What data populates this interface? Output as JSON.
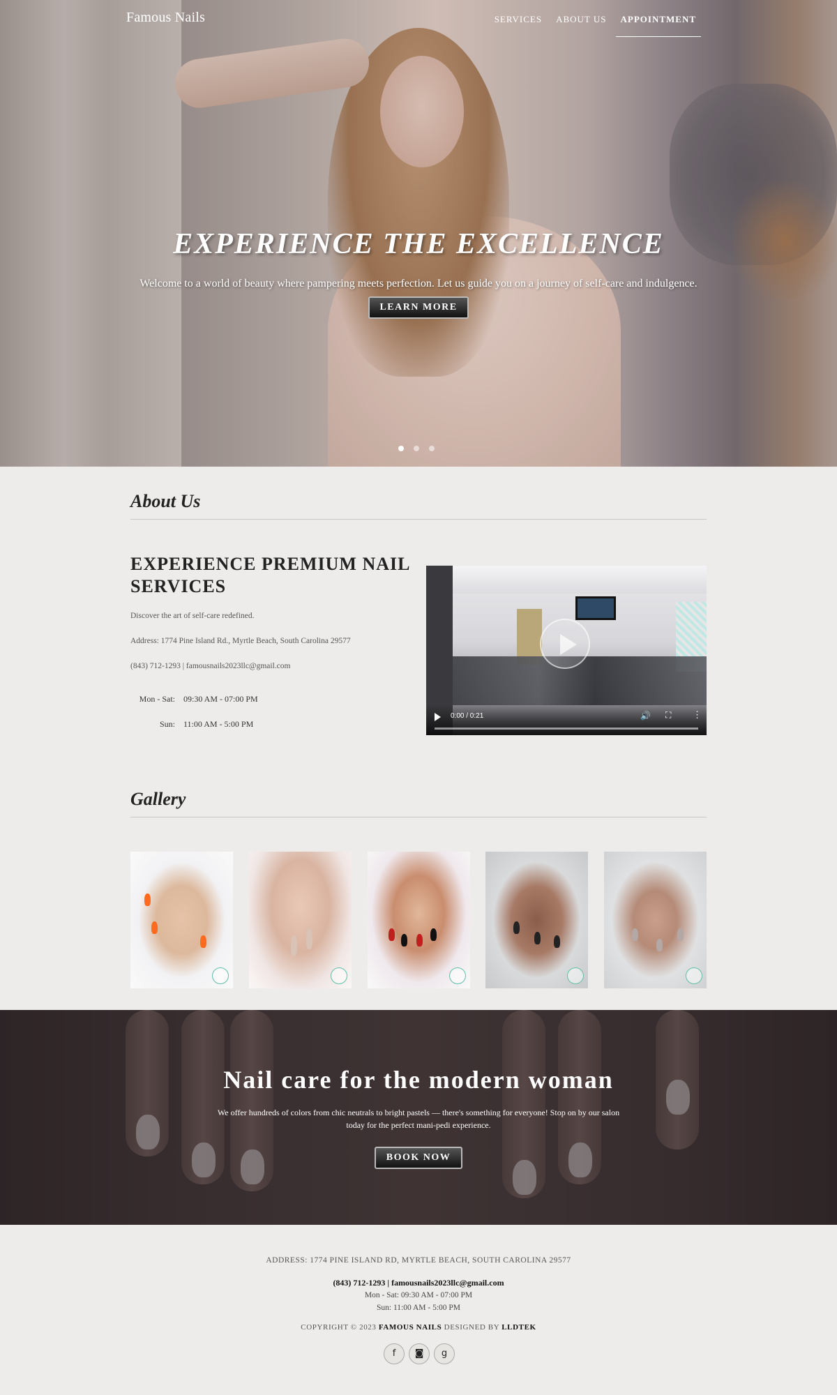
{
  "header": {
    "brand": "Famous Nails",
    "nav": [
      {
        "label": "SERVICES",
        "active": false
      },
      {
        "label": "ABOUT US",
        "active": false
      },
      {
        "label": "APPOINTMENT",
        "active": true
      }
    ]
  },
  "hero": {
    "title": "EXPERIENCE THE EXCELLENCE",
    "subtitle": "Welcome to a world of beauty where pampering meets perfection. Let us guide you on a journey of self-care and indulgence.",
    "button_label": "LEARN MORE",
    "slides_total": 3,
    "active_slide": 1
  },
  "about": {
    "heading": "About Us",
    "title": "EXPERIENCE PREMIUM NAIL SERVICES",
    "tagline": "Discover the art of self-care redefined.",
    "address": "Address: 1774 Pine Island Rd., Myrtle Beach, South Carolina 29577",
    "contact": "(843) 712-1293 | famousnails2023llc@gmail.com",
    "hours": [
      {
        "day": "Mon - Sat:",
        "time": "09:30 AM - 07:00 PM"
      },
      {
        "day": "Sun:",
        "time": "11:00 AM - 5:00 PM"
      }
    ],
    "video": {
      "time": "0:00 / 0:21"
    }
  },
  "gallery": {
    "heading": "Gallery",
    "items": [
      "gallery-image-1",
      "gallery-image-2",
      "gallery-image-3",
      "gallery-image-4",
      "gallery-image-5"
    ]
  },
  "promo": {
    "title": "Nail care for the modern woman",
    "text": "We offer hundreds of colors from chic neutrals to bright pastels — there's something for everyone! Stop on by our salon today for the perfect mani-pedi experience.",
    "button_label": "BOOK NOW"
  },
  "footer": {
    "address": "ADDRESS: 1774 PINE ISLAND RD, MYRTLE BEACH, SOUTH CAROLINA 29577",
    "contact": "(843) 712-1293 | famousnails2023llc@gmail.com",
    "hours_weekday": "Mon - Sat: 09:30 AM - 07:00 PM",
    "hours_sunday": "Sun: 11:00 AM - 5:00 PM",
    "copyright_prefix": "COPYRIGHT © 2023",
    "copyright_brand": "FAMOUS NAILS",
    "copyright_middle": "DESIGNED BY",
    "copyright_designer": "LLDTEK",
    "social": [
      {
        "icon": "facebook-icon",
        "glyph": "f"
      },
      {
        "icon": "instagram-icon",
        "glyph": "◙"
      },
      {
        "icon": "google-icon",
        "glyph": "g"
      }
    ]
  },
  "colors": {
    "page_bg": "#edecea",
    "button_dark": "#222222",
    "promo_bg": "#3a3133",
    "logo_accent": "#5fbfa8"
  }
}
